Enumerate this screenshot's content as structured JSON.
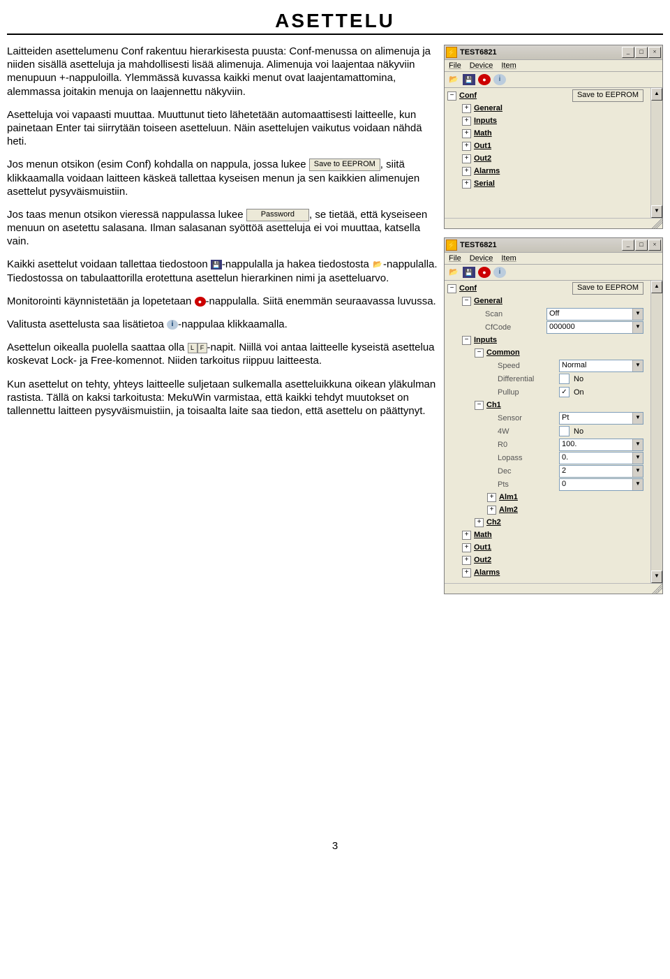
{
  "title": "ASETTELU",
  "page_number": "3",
  "paragraphs": {
    "p1": "Laitteiden asettelumenu Conf rakentuu hierarkisesta puusta: Conf-menussa on alimenuja ja niiden sisällä asetteluja ja mahdollisesti lisää alimenuja. Alimenuja voi laajentaa näkyviin menupuun +-nappuloilla. Ylemmässä kuvassa kaikki menut ovat laajentamattomina, alemmassa joitakin menuja on laajennettu näkyviin.",
    "p2": "Asetteluja voi vapaasti muuttaa. Muuttunut tieto lähetetään automaattisesti laitteelle, kun painetaan Enter tai siirrytään toiseen asetteluun. Näin asettelujen vaikutus voidaan nähdä heti.",
    "p3a": "Jos menun otsikon (esim Conf) kohdalla on nappula, jossa lukee ",
    "p3b": ", siitä klikkaamalla voidaan laitteen käskeä tallettaa kyseisen menun ja sen kaikkien alimenujen asettelut pysyväismuistiin.",
    "p4a": "Jos taas menun otsikon vieressä nappulassa lukee ",
    "p4b": ", se tietää, että kyseiseen menuun on asetettu salasana. Ilman salasanan syöttöä asetteluja ei voi muuttaa, katsella vain.",
    "p5a": "Kaikki asettelut voidaan tallettaa tiedostoon ",
    "p5b": "-nappulalla ja hakea tiedostosta ",
    "p5c": "-nappulalla. Tiedostossa on tabulaattorilla erotettuna asettelun hierarkinen nimi ja asetteluarvo.",
    "p6a": "Monitorointi käynnistetään ja lopetetaan ",
    "p6b": "-nappulalla. Siitä enemmän seuraavassa luvussa.",
    "p7a": "Valitusta asettelusta saa lisätietoa ",
    "p7b": "-nappulaa klikkaamalla.",
    "p8a": "Asettelun oikealla puolella saattaa olla ",
    "p8b": "-napit. Niillä voi antaa laitteelle kyseistä asettelua koskevat Lock- ja Free-komennot. Niiden tarkoitus riippuu laitteesta.",
    "p9": "Kun asettelut on tehty, yhteys laitteelle suljetaan sulkemalla asetteluikkuna oikean yläkulman rastista. Tällä on kaksi tarkoitusta: MekuWin varmistaa, että kaikki tehdyt muutokset on tallennettu laitteen pysyväismuistiin, ja toisaalta laite saa tiedon, että asettelu on päättynyt."
  },
  "inline_buttons": {
    "save_eeprom": "Save to EEPROM",
    "password": "Password",
    "L": "L",
    "F": "F"
  },
  "window1": {
    "title": "TEST6821",
    "menus": [
      "File",
      "Device",
      "Item"
    ],
    "save_btn": "Save to EEPROM",
    "tree": {
      "root": "Conf",
      "items": [
        "General",
        "Inputs",
        "Math",
        "Out1",
        "Out2",
        "Alarms",
        "Serial"
      ]
    }
  },
  "window2": {
    "title": "TEST6821",
    "menus": [
      "File",
      "Device",
      "Item"
    ],
    "save_btn": "Save to EEPROM",
    "root": "Conf",
    "general": {
      "label": "General",
      "scan": {
        "lbl": "Scan",
        "val": "Off"
      },
      "cfcode": {
        "lbl": "CfCode",
        "val": "000000"
      }
    },
    "inputs": {
      "label": "Inputs",
      "common": {
        "label": "Common",
        "speed": {
          "lbl": "Speed",
          "val": "Normal"
        },
        "differential": {
          "lbl": "Differential",
          "checked": false,
          "txt": "No"
        },
        "pullup": {
          "lbl": "Pullup",
          "checked": true,
          "txt": "On"
        }
      },
      "ch1": {
        "label": "Ch1",
        "sensor": {
          "lbl": "Sensor",
          "val": "Pt"
        },
        "w4": {
          "lbl": "4W",
          "checked": false,
          "txt": "No"
        },
        "r0": {
          "lbl": "R0",
          "val": "100."
        },
        "lopass": {
          "lbl": "Lopass",
          "val": "0."
        },
        "dec": {
          "lbl": "Dec",
          "val": "2"
        },
        "pts": {
          "lbl": "Pts",
          "val": "0"
        },
        "alm1": "Alm1",
        "alm2": "Alm2"
      },
      "ch2": "Ch2"
    },
    "others": [
      "Math",
      "Out1",
      "Out2",
      "Alarms"
    ]
  }
}
